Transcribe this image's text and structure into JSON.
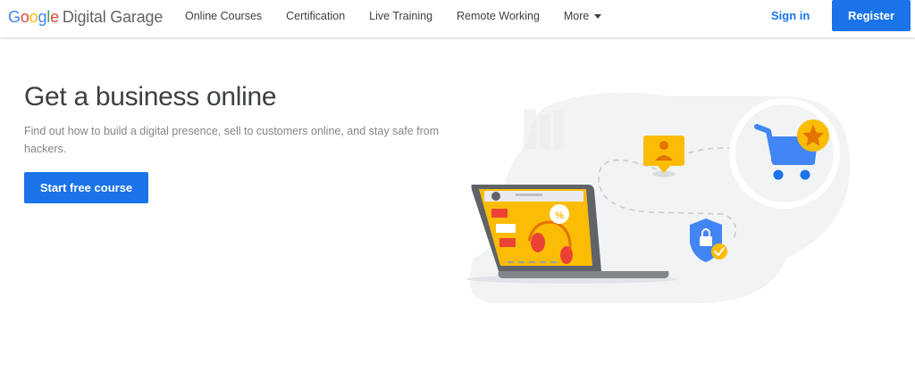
{
  "header": {
    "logo": {
      "g1": "G",
      "o1": "o",
      "o2": "o",
      "g2": "g",
      "l": "l",
      "e": "e",
      "brand": "Digital Garage"
    },
    "nav": [
      {
        "label": "Online Courses"
      },
      {
        "label": "Certification"
      },
      {
        "label": "Live Training"
      },
      {
        "label": "Remote Working"
      },
      {
        "label": "More"
      }
    ],
    "sign_in_label": "Sign in",
    "register_label": "Register"
  },
  "hero": {
    "title": "Get a business online",
    "description": "Find out how to build a digital presence, sell to customers online, and stay safe from hackers.",
    "cta_label": "Start free course"
  },
  "illustration": {
    "laptop_badge_text": "%",
    "icons": [
      "user-location-icon",
      "shopping-cart-icon",
      "star-icon",
      "security-shield-icon",
      "checkmark-icon",
      "laptop-icon",
      "headphones-icon"
    ]
  },
  "colors": {
    "primary_blue": "#1a73e8",
    "google_blue": "#4285f4",
    "google_red": "#ea4335",
    "google_yellow": "#fbbc05",
    "google_green": "#34a853"
  }
}
